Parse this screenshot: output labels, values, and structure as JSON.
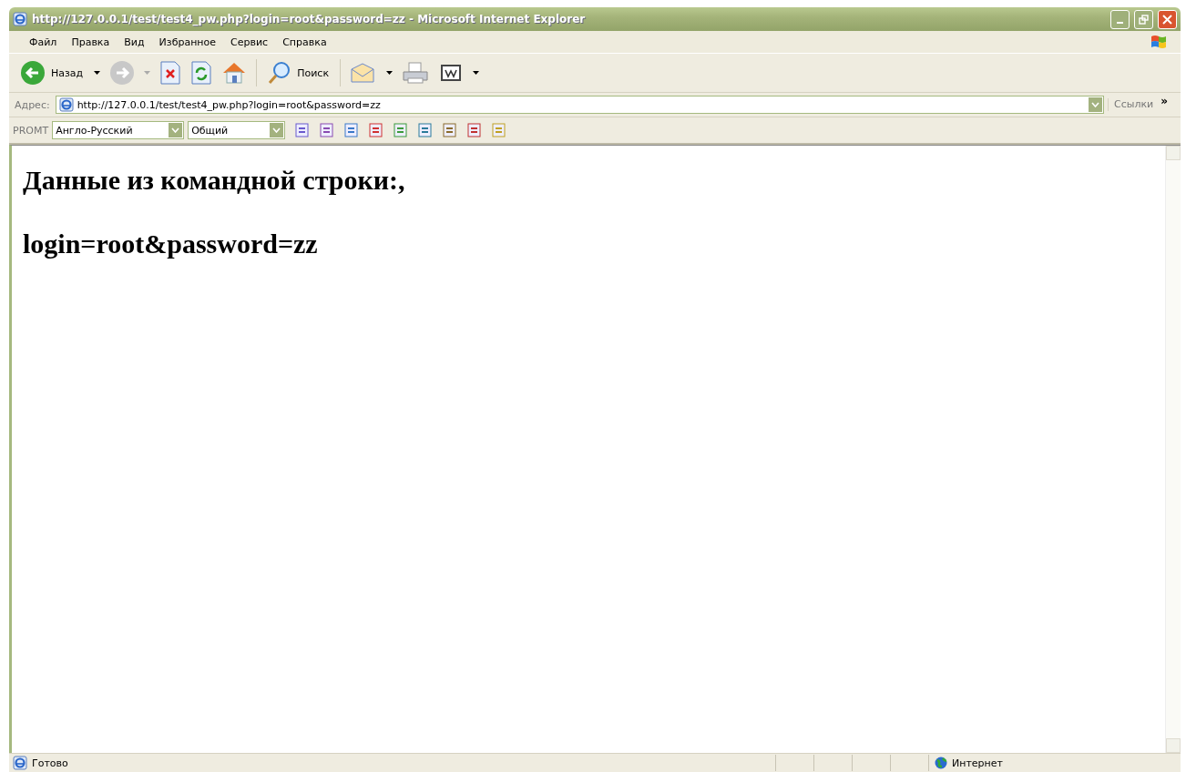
{
  "window": {
    "title": "http://127.0.0.1/test/test4_pw.php?login=root&password=zz - Microsoft Internet Explorer"
  },
  "menu": [
    "Файл",
    "Правка",
    "Вид",
    "Избранное",
    "Сервис",
    "Справка"
  ],
  "toolbar": {
    "back_label": "Назад",
    "search_label": "Поиск"
  },
  "address_bar": {
    "label": "Адрес:",
    "value": "http://127.0.0.1/test/test4_pw.php?login=root&password=zz",
    "links": "Ссылки",
    "more": "»"
  },
  "promt_bar": {
    "label": "PROMT",
    "direction": "Англо-Русский",
    "topic": "Общий"
  },
  "page": {
    "lines": [
      "Данные из командной строки:,",
      "login=root&password=zz"
    ]
  },
  "status_bar": {
    "text": "Готово",
    "zone": "Интернет"
  }
}
